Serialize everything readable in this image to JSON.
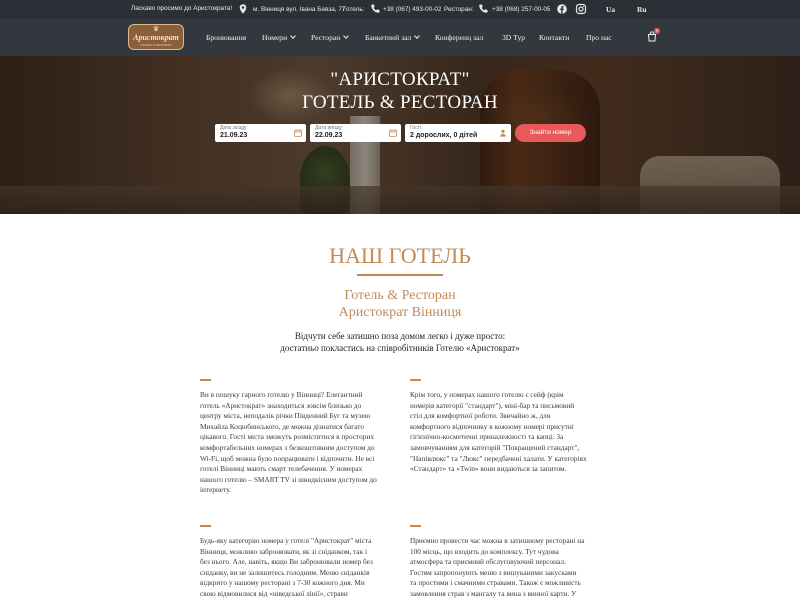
{
  "topbar": {
    "welcome": "Ласкаво просимо до Аристократа!",
    "address": "м. Вінниця вул. Івана Бевза, 77",
    "hotel_label": "Готель:",
    "hotel_phone": "+38 (067) 493-00-02",
    "restaurant_label": "Ресторан:",
    "restaurant_phone": "+38 (068) 257-00-05",
    "languages": [
      "Ua",
      "Ru"
    ]
  },
  "nav": {
    "logo_text": "Аристократ",
    "logo_sub": "ГОТЕЛЬ & РЕСТОРАН",
    "items": [
      {
        "label": "Бронювання",
        "dropdown": false
      },
      {
        "label": "Номери",
        "dropdown": true
      },
      {
        "label": "Ресторан",
        "dropdown": true
      },
      {
        "label": "Банкетний зал",
        "dropdown": true
      },
      {
        "label": "Конференц зал",
        "dropdown": false
      },
      {
        "label": "3D Тур",
        "dropdown": false
      },
      {
        "label": "Контакти",
        "dropdown": false
      },
      {
        "label": "Про нас",
        "dropdown": false
      }
    ],
    "cart_count": "0"
  },
  "hero": {
    "title_line1": "\"АРИСТОКРАТ\"",
    "title_line2": "ГОТЕЛЬ & РЕСТОРАН",
    "booking": {
      "checkin_label": "Дата заїзду",
      "checkin_value": "21.09.23",
      "checkout_label": "Дата виїзду",
      "checkout_value": "22.09.23",
      "guests_label": "Гості",
      "guests_value": "2 дорослих, 0 дітей",
      "search_button": "Знайти номер"
    }
  },
  "content": {
    "heading": "НАШ ГОТЕЛЬ",
    "subtitle_line1": "Готель & Ресторан",
    "subtitle_line2": "Аристократ Вінниця",
    "lead_line1": "Відчути себе затишно поза домом легко і дуже просто:",
    "lead_line2": "достатньо покластись на співробітників Готелю «Аристократ»",
    "p1": [
      "Ви в пошуку гарного готелю у Вінниці? Елегантний",
      "готель «Аристократ» знаходиться зовсім близько до",
      "центру міста, неподалік річки Південний Буг та музею",
      "Михайла Коцюбинського, де можна дізнатися багато",
      "цікавого. Гості міста зможуть розміститися в просторих",
      "комфортабельних номерах з безкоштовним доступом до",
      "Wi-Fi, щоб можна було попрацювати і відпочити. Не всі",
      "готелі Вінниці мають смарт телебачення. У номерах",
      "нашого готелю – SMART TV зі швидкісним доступом до",
      "інтернету."
    ],
    "p2": [
      "Крім того, у номерах нашого готелю є сейф (крім",
      "номерів категорії \"стандарт\"), міні-бар та письмовий",
      "стіл для комфортної роботи. Звичайно ж, для",
      "комфортного відпочинку в кожному номері присутні",
      "гігієнічно-косметичні приналежності та капці. За",
      "замовчуванням для категорій \"Покращений стандарт\",",
      "\"Напівлюкс\" та \"Люкс\" передбачені халати. У категоріях",
      "«Стандарт» та «Twin» вони видаються за запитом."
    ],
    "p3": [
      "Будь-яку категорію номера у готелі \"Аристократ\" міста",
      "Вінниця, можливо забронювати, як зі сніданком, так і",
      "без нього. Але, навіть, якщо Ви забронювали номер без",
      "сніданку, ви не залишитесь голодним. Меню сніданків",
      "відкрито у нашому ресторані з 7-30 кожного дня.  Ми",
      "свою відмовилися від «шведської лінії», страви"
    ],
    "p4": [
      "Приємно провести час можна в затишному ресторані на",
      "100 місць, що входить до комплексу. Тут чудова",
      "атмосфера та приємний обслуговуючий персонал.",
      "Гостям запропонують меню з вишуканими закусками",
      "та простими і смачними стравами. Також є можливість",
      "замовлення страв з мангалу та вина з винної карти. У"
    ]
  },
  "colors": {
    "accent": "#c38a55",
    "topbar_bg": "#2c2f35",
    "nav_bg": "#33373e",
    "button": "#e9585a"
  }
}
